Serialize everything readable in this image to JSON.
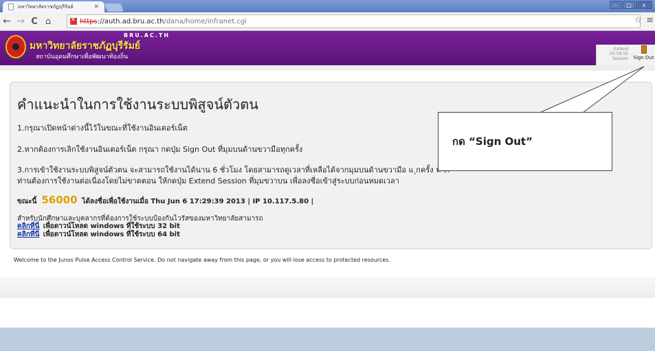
{
  "browser": {
    "tab_title": "มหาวิทยาลัยราชภัฏบุรีรัมย์",
    "tab_close": "×",
    "url_scheme": "https",
    "url_host": "://auth.ad.bru.ac.th",
    "url_path": "/dana/home/infranet.cgi",
    "window_buttons": [
      "–",
      "□",
      "x"
    ]
  },
  "header": {
    "domain_text": "BRU.AC.TH",
    "university_name": "มหาวิทยาลัยราชภัฏบุรีรัมย์",
    "university_tagline": "สถาบันอุดมศึกษาเพื่อพัฒนาท้องถิ่น",
    "extend_label": "Extend",
    "extend_time": "05:59:55",
    "extend_session": "Session",
    "signout_label": "Sign Out"
  },
  "content": {
    "title": "คำแนะนำในการใช้งานระบบพิสูจน์ตัวตน",
    "line1": "1.กรุณาเปิดหน้าต่างนี้ไว้ในขณะที่ใช้งานอินเตอร์เน็ต",
    "line2": "2.หากต้องการเลิกใช้งานอินเตอร์เน็ต กรุณา กดปุ่ม Sign Out ที่มุมบนด้านขวามือทุกครั้ง",
    "line3": "3.การเข้าใช้งานระบบพิสูจน์ตัวตน จะสามารถใช้งานได้นาน 6 ชั่วโมง โดยสามารถดูเวลาที่เหลือได้จากมุมบนด้านขวามือ แ                                                                                    ุกครั้ง หาก",
    "line4": "ท่านต้องการใช้งานต่อเนื่องโดยไม่ขาดตอน ให้กดปุ่ม Extend Session ที่มุมขวาบน เพื่อลงชื่อเข้าสู่ระบบก่อนหมดเวลา",
    "session_prefix": "ขณะนี้",
    "session_timer": "56000",
    "session_text": "ได้ลงชื่อเพื่อใช้งานเมื่อ Thu Jun 6 17:29:39 2013 | IP 10.117.5.80 |",
    "antivirus_note": "สำหรับนักศึกษาและบุคลากรที่ต้องการใช้ระบบป้องกันไวรัสของมหาวิทยาลัยสามารถ",
    "dl32_link": "คลิกที่นี่",
    "dl32_text": "เพื่อดาวน์โหลด windows ที่ใช้ระบบ 32 bit",
    "dl64_link": "คลิกที่นี่",
    "dl64_text": "เพื่อดาวน์โหลด windows ที่ใช้ระบบ 64 bit",
    "footer": "Welcome to the Junos Pulse Access Control Service. Do not navigate away from this page, or you will lose access to protected resources."
  },
  "callout": {
    "text": "กด “Sign Out”"
  },
  "icons": [
    "doc-icon",
    "back-icon",
    "forward-icon",
    "reload-icon",
    "home-icon",
    "lock-broken-icon",
    "star-icon",
    "menu-icon",
    "logo-icon",
    "door-icon"
  ]
}
